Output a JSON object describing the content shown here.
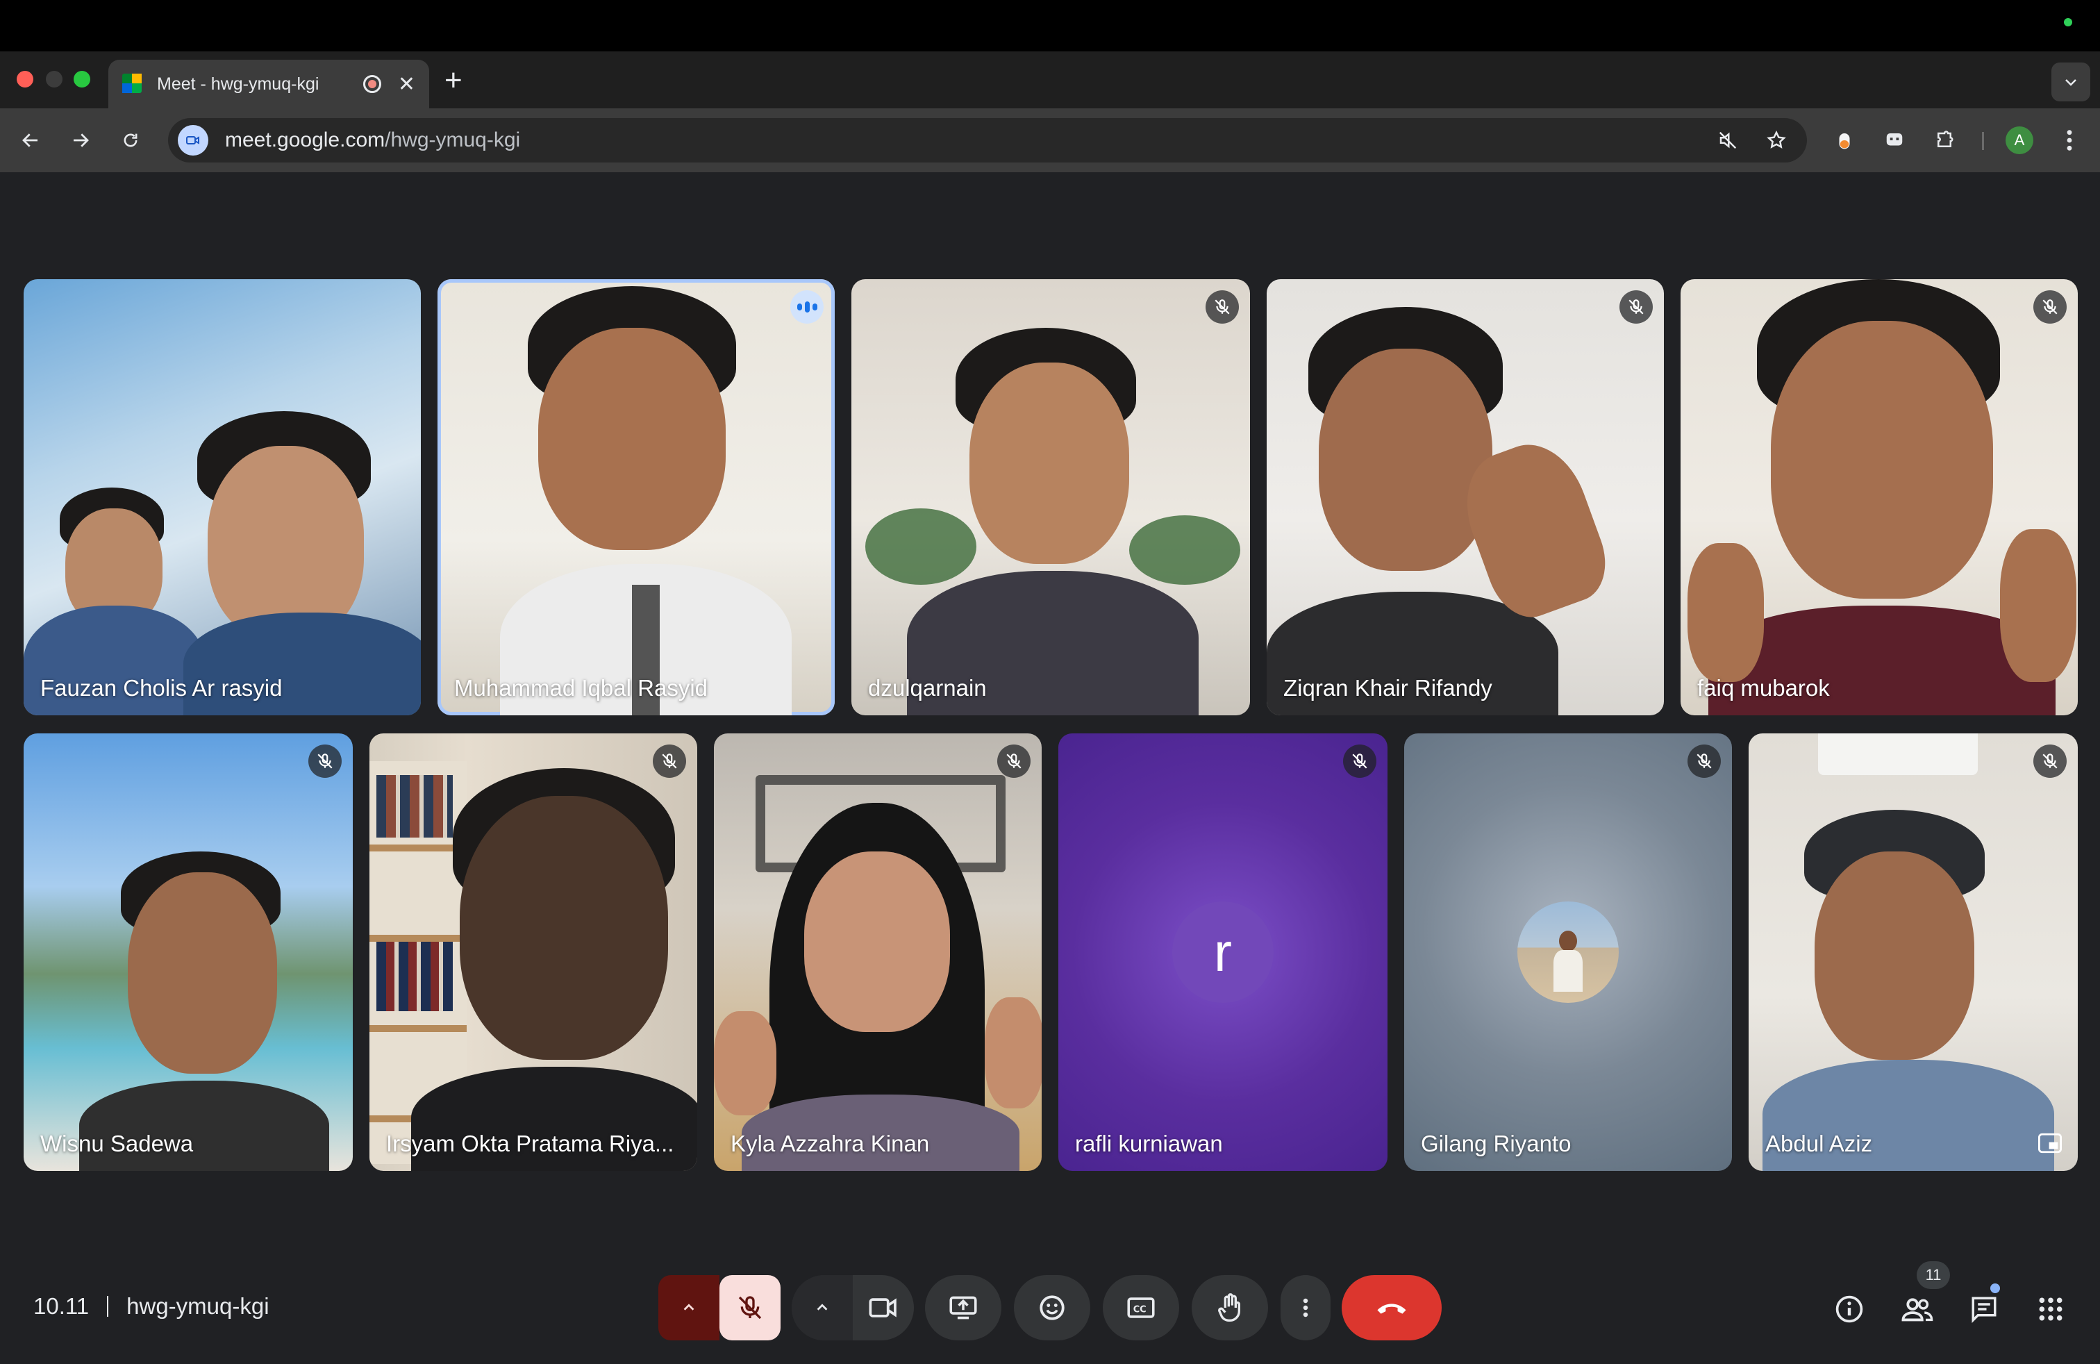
{
  "browser": {
    "tab_title": "Meet - hwg-ymuq-kgi",
    "url_domain": "meet.google.com",
    "url_path": "/hwg-ymuq-kgi",
    "profile_initial": "A"
  },
  "meeting": {
    "time": "10.11",
    "code": "hwg-ymuq-kgi",
    "participant_count": "11"
  },
  "participants": [
    {
      "name": "Fauzan Cholis Ar rasyid",
      "muted": false
    },
    {
      "name": "Muhammad Iqbal Rasyid",
      "muted": false,
      "speaking": true
    },
    {
      "name": "dzulqarnain",
      "muted": true
    },
    {
      "name": "Ziqran Khair Rifandy",
      "muted": true
    },
    {
      "name": "faiq mubarok",
      "muted": true
    },
    {
      "name": "Wisnu Sadewa",
      "muted": true
    },
    {
      "name": "Irsyam Okta Pratama Riya...",
      "muted": true
    },
    {
      "name": "Kyla Azzahra Kinan",
      "muted": true
    },
    {
      "name": "rafli kurniawan",
      "muted": true,
      "avatar_letter": "r",
      "avatar_color": "#7248b9"
    },
    {
      "name": "Gilang Riyanto",
      "muted": true
    },
    {
      "name": "Abdul Aziz",
      "muted": true
    }
  ],
  "colors": {
    "stage_bg": "#202124",
    "mic_off_bg": "#f9dedc",
    "end_call": "#dc362e",
    "active_outline": "#a8c7fa"
  },
  "controls": [
    "mic-off",
    "camera",
    "present",
    "emoji",
    "captions",
    "raise-hand",
    "more",
    "end-call"
  ],
  "right_controls": [
    "info",
    "people",
    "chat",
    "activities"
  ]
}
